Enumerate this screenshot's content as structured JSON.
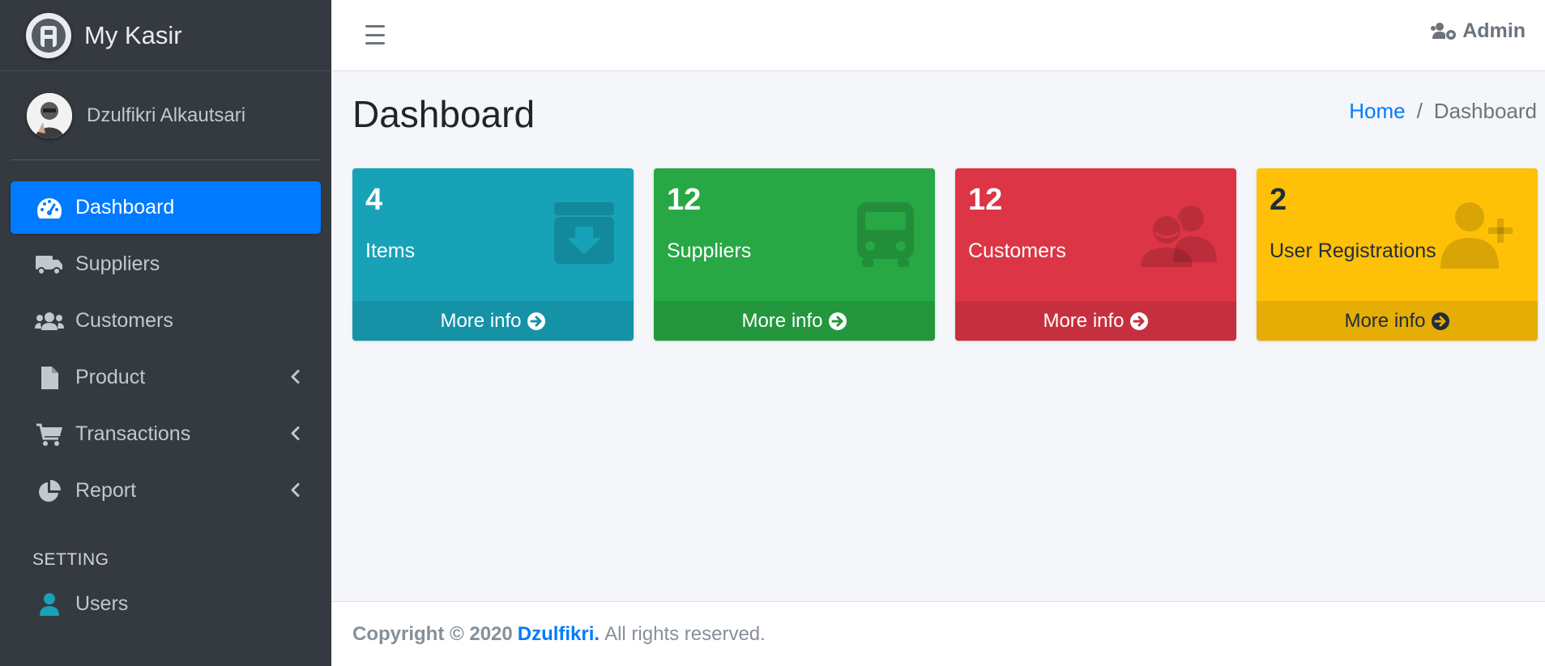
{
  "brand": {
    "name": "My Kasir"
  },
  "user": {
    "name": "Dzulfikri Alkautsari"
  },
  "sidebar": {
    "items": [
      {
        "label": "Dashboard",
        "icon": "tachometer-icon",
        "active": true
      },
      {
        "label": "Suppliers",
        "icon": "truck-icon"
      },
      {
        "label": "Customers",
        "icon": "users-icon"
      },
      {
        "label": "Product",
        "icon": "file-icon",
        "has_submenu": true
      },
      {
        "label": "Transactions",
        "icon": "shopping-cart-icon",
        "has_submenu": true
      },
      {
        "label": "Report",
        "icon": "pie-chart-icon",
        "has_submenu": true
      }
    ],
    "setting_header": "SETTING",
    "setting_items": [
      {
        "label": "Users",
        "icon": "user-icon"
      }
    ]
  },
  "topbar": {
    "user_menu": "Admin"
  },
  "page": {
    "title": "Dashboard",
    "breadcrumb": {
      "home": "Home",
      "separator": "/",
      "current": "Dashboard"
    }
  },
  "stats": [
    {
      "value": "4",
      "label": "Items",
      "link": "More info",
      "color": "#17a2b8",
      "icon": "archive-icon"
    },
    {
      "value": "12",
      "label": "Suppliers",
      "link": "More info",
      "color": "#28a745",
      "icon": "bus-icon"
    },
    {
      "value": "12",
      "label": "Customers",
      "link": "More info",
      "color": "#dc3545",
      "icon": "user-friends-icon"
    },
    {
      "value": "2",
      "label": "User Registrations",
      "link": "More info",
      "color": "#ffc107",
      "icon": "user-plus-icon"
    }
  ],
  "footer": {
    "copyright": "Copyright © 2020",
    "author": "Dzulfikri.",
    "rights": "All rights reserved."
  }
}
